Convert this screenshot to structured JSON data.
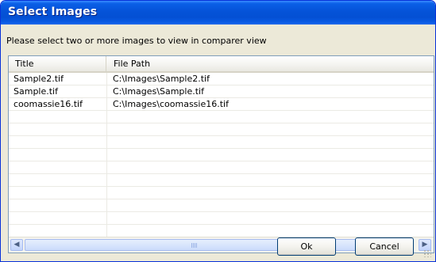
{
  "window": {
    "title": "Select Images"
  },
  "instruction": "Please select two or more images to view in comparer view",
  "list": {
    "columns": [
      "Title",
      "File Path"
    ],
    "rows": [
      {
        "title": "Sample2.tif",
        "path": "C:\\Images\\Sample2.tif"
      },
      {
        "title": "Sample.tif",
        "path": "C:\\Images\\Sample.tif"
      },
      {
        "title": "coomassie16.tif",
        "path": "C:\\Images\\coomassie16.tif"
      }
    ],
    "empty_rows": 9
  },
  "scrollbar": {
    "left_icon": "chevron-left-icon",
    "right_icon": "chevron-right-icon"
  },
  "buttons": {
    "ok_label": "Ok",
    "cancel_label": "Cancel"
  },
  "colors": {
    "titlebar": "#0553d8",
    "window_bg": "#ece9d8",
    "list_border": "#7f9db9"
  }
}
